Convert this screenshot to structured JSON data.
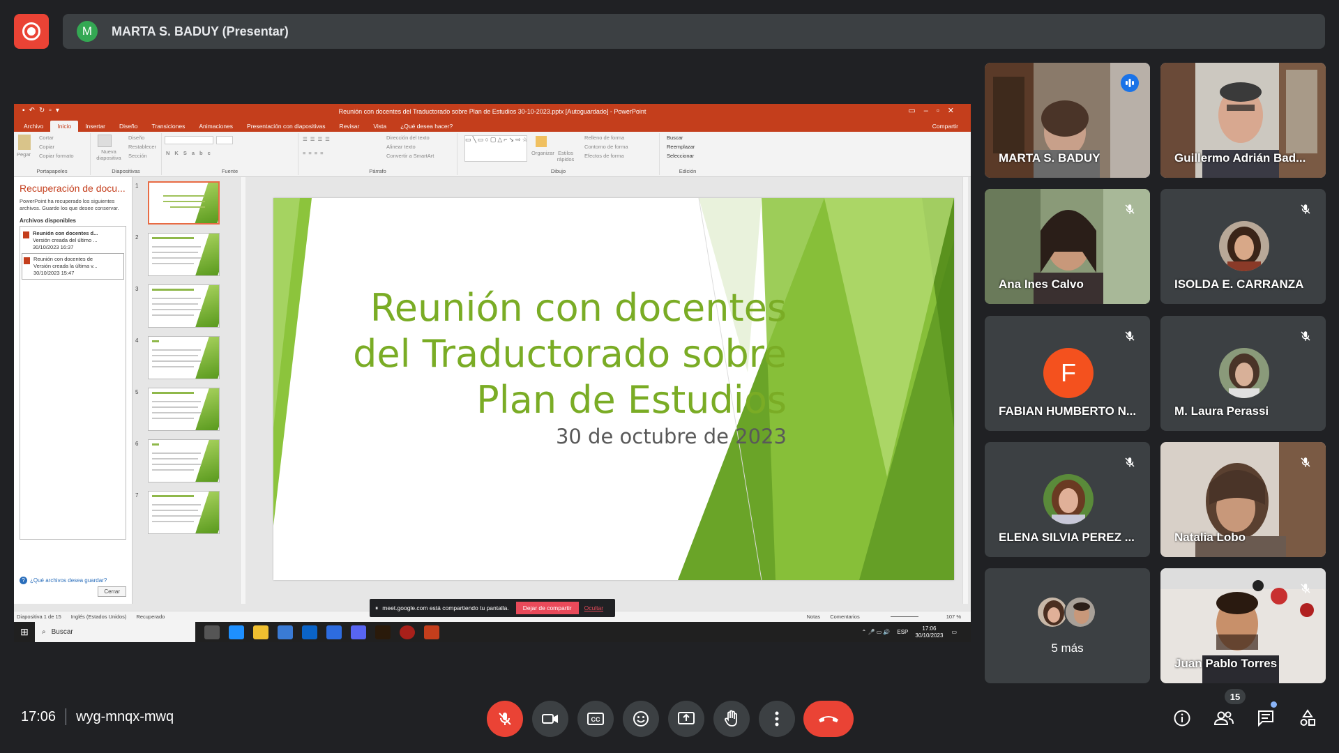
{
  "presenter": {
    "initial": "M",
    "name": "MARTA S. BADUY (Presentar)"
  },
  "powerpoint": {
    "window_title": "Reunión con docentes del Traductorado sobre Plan de Estudios 30-10-2023.pptx [Autoguardado] - PowerPoint",
    "tabs": [
      "Archivo",
      "Inicio",
      "Insertar",
      "Diseño",
      "Transiciones",
      "Animaciones",
      "Presentación con diapositivas",
      "Revisar",
      "Vista",
      "¿Qué desea hacer?"
    ],
    "share_label": "Compartir",
    "ribbon": {
      "portapapeles": {
        "paste": "Pegar",
        "cut": "Cortar",
        "copy": "Copiar",
        "format": "Copiar formato",
        "name": "Portapapeles"
      },
      "diapositivas": {
        "new": "Nueva diapositiva",
        "layout": "Diseño",
        "reset": "Restablecer",
        "section": "Sección",
        "name": "Diapositivas"
      },
      "fuente": {
        "name": "Fuente"
      },
      "parrafo": {
        "dir": "Dirección del texto",
        "align": "Alinear texto",
        "smart": "Convertir a SmartArt",
        "name": "Párrafo"
      },
      "dibujo": {
        "organize": "Organizar",
        "styles": "Estilos rápidos",
        "fill": "Relleno de forma",
        "outline": "Contorno de forma",
        "effects": "Efectos de forma",
        "name": "Dibujo"
      },
      "edicion": {
        "find": "Buscar",
        "replace": "Reemplazar",
        "select": "Seleccionar",
        "name": "Edición"
      }
    },
    "recovery": {
      "title": "Recuperación de docu...",
      "desc": "PowerPoint ha recuperado los siguientes archivos. Guarde los que desee conservar.",
      "available": "Archivos disponibles",
      "files": [
        {
          "name": "Reunión con docentes d...",
          "detail": "Versión creada del último ...",
          "date": "30/10/2023 16:37"
        },
        {
          "name": "Reunión con docentes de",
          "detail": "Versión creada la última v...",
          "date": "30/10/2023 15:47"
        }
      ],
      "question": "¿Qué archivos desea guardar?",
      "close": "Cerrar"
    },
    "thumbnails": [
      "1",
      "2",
      "3",
      "4",
      "5",
      "6",
      "7"
    ],
    "slide": {
      "title_lines": [
        "Reunión con docentes",
        "del Traductorado sobre",
        "Plan de Estudios"
      ],
      "date": "30 de octubre de 2023"
    },
    "status": {
      "slide": "Diapositiva 1 de 15",
      "lang": "Inglés (Estados Unidos)",
      "recovered": "Recuperado",
      "notes": "Notas",
      "comments": "Comentarios",
      "zoom": "107 %"
    },
    "share_notice": {
      "text": "meet.google.com está compartiendo tu pantalla.",
      "stop": "Dejar de compartir",
      "hide": "Ocultar"
    },
    "taskbar": {
      "search": "Buscar",
      "lang": "ESP",
      "time": "17:06",
      "date": "30/10/2023"
    }
  },
  "participants": [
    {
      "name": "MARTA S. BADUY",
      "speaking": true
    },
    {
      "name": "Guillermo Adrián Bad..."
    },
    {
      "name": "Ana Ines Calvo",
      "muted": true
    },
    {
      "name": "ISOLDA E. CARRANZA",
      "muted": true
    },
    {
      "name": "FABIAN HUMBERTO N...",
      "muted": true,
      "initial": "F"
    },
    {
      "name": "M. Laura Perassi",
      "muted": true
    },
    {
      "name": "ELENA SILVIA PEREZ ...",
      "muted": true
    },
    {
      "name": "Natalia Lobo",
      "muted": true
    },
    {
      "name": "5 más"
    },
    {
      "name": "Juan Pablo Torres",
      "muted": true
    }
  ],
  "meeting": {
    "time": "17:06",
    "code": "wyg-mnqx-mwq",
    "people_count": "15"
  },
  "colors": {
    "background": "#202124",
    "tile": "#3c4043",
    "danger": "#ea4335",
    "accent": "#8ab4f8",
    "slide_green": "#7aac25",
    "ppt_orange": "#c43e1c"
  }
}
